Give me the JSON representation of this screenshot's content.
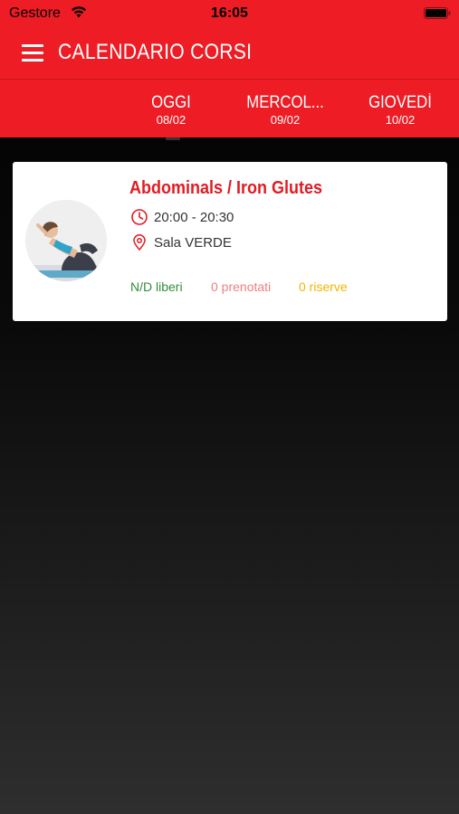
{
  "status_bar": {
    "carrier": "Gestore",
    "time": "16:05",
    "icons": [
      "wifi-icon",
      "battery-icon"
    ]
  },
  "header": {
    "title": "CALENDARIO CORSI",
    "menu_icon": "hamburger-menu-icon"
  },
  "tabs": [
    {
      "name": "OGGI",
      "date": "08/02"
    },
    {
      "name": "MERCOL...",
      "date": "09/02"
    },
    {
      "name": "GIOVEDÌ",
      "date": "10/02"
    }
  ],
  "course": {
    "title": "Abdominals / Iron Glutes",
    "time": "20:00 - 20:30",
    "room": "Sala VERDE",
    "free": "N/D liberi",
    "booked": "0 prenotati",
    "reserves": "0 riserve"
  },
  "colors": {
    "brand_red": "#ee1c25",
    "title_red": "#e11b22",
    "free_green": "#2f8f3a",
    "booked_pink": "#ef7f80",
    "reserve_yellow": "#f2b400"
  }
}
